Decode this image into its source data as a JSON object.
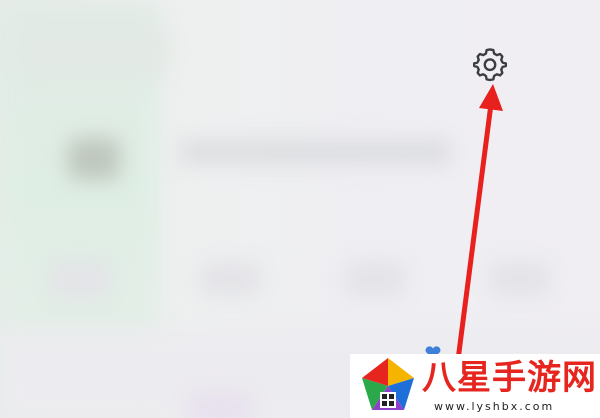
{
  "screen": {
    "background_blurred": true
  },
  "settings": {
    "icon": "gear-icon",
    "color": "#3a3d42"
  },
  "annotation": {
    "type": "arrow",
    "color": "#e8211e"
  },
  "watermark": {
    "brand_text": "八星手游网",
    "url_text": "www.lyshbx.com",
    "brand_color": "#e6251e"
  }
}
